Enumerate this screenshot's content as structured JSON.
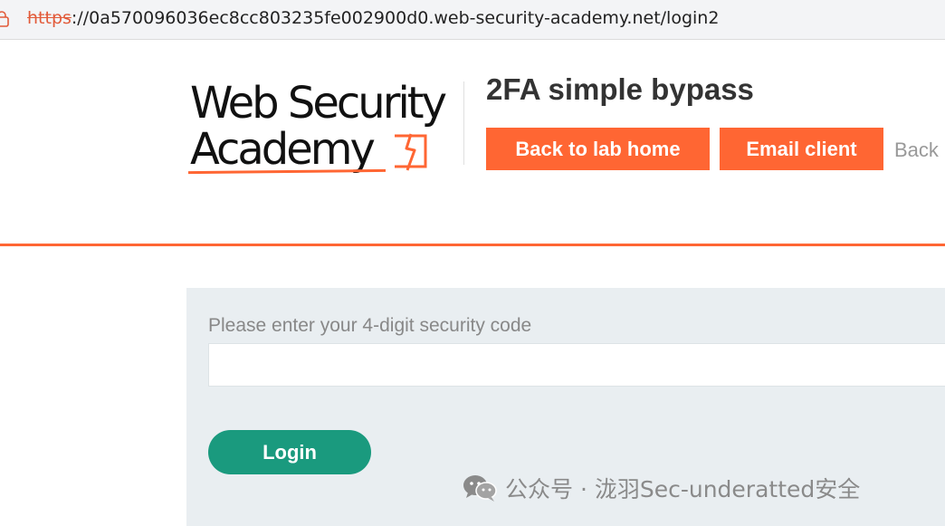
{
  "browser": {
    "url_scheme": "https",
    "url_rest": "://0a570096036ec8cc803235fe002900d0.web-security-academy.net/login2"
  },
  "header": {
    "logo_line1": "Web Security",
    "logo_line2": "Academy",
    "lab_title": "2FA simple bypass",
    "back_to_lab_home": "Back to lab home",
    "email_client": "Email client",
    "back_link": "Back"
  },
  "form": {
    "label": "Please enter your 4-digit security code",
    "code_value": "",
    "login_label": "Login"
  },
  "watermark": {
    "text": "公众号 · 泷羽Sec-underatted安全"
  },
  "colors": {
    "accent_orange": "#ff6633",
    "login_green": "#1a9a7e",
    "panel_bg": "#e9eef1"
  },
  "icons": {
    "lock": "lock-icon",
    "logo_mark": "lightning-bolt-icon",
    "wechat": "wechat-icon"
  }
}
